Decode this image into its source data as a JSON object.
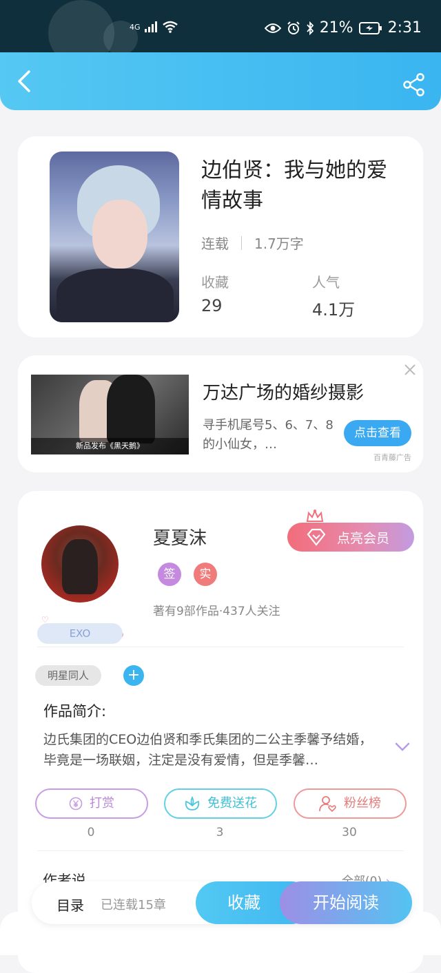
{
  "status_bar": {
    "network": "4G",
    "battery_percent": "21%",
    "time": "2:31"
  },
  "book": {
    "title": "边伯贤：我与她的爱情故事",
    "status": "连载",
    "word_count": "1.7万字",
    "favorites_label": "收藏",
    "favorites_value": "29",
    "popularity_label": "人气",
    "popularity_value": "4.1万"
  },
  "ad": {
    "title": "万达广场的婚纱摄影",
    "description": "寻手机尾号5、6、7、8的小仙女，…",
    "button_label": "点击查看",
    "source_tag": "百青藤广告",
    "image_caption": "新品发布《黑天鹅》"
  },
  "author": {
    "name": "夏夏沫",
    "vip_label": "点亮会员",
    "badge_sign": "签",
    "badge_real": "实",
    "stats": "著有9部作品·437人关注",
    "fan_tag": "EXO"
  },
  "genre_tag": "明星同人",
  "add_tag": "+",
  "intro": {
    "title": "作品简介:",
    "text": "边氏集团的CEO边伯贤和季氏集团的二公主季馨予结婚，毕竟是一场联姻，注定是没有爱情，但是季馨…"
  },
  "actions": [
    {
      "label": "打赏",
      "count": "0"
    },
    {
      "label": "免费送花",
      "count": "3"
    },
    {
      "label": "粉丝榜",
      "count": "30"
    }
  ],
  "author_note": {
    "title": "作者说",
    "all_label": "全部(0)"
  },
  "bottom_bar": {
    "toc_label": "目录",
    "serial_label": "已连载15章",
    "favorite_label": "收藏",
    "read_label": "开始阅读"
  },
  "colors": {
    "accent": "#3ab5f0",
    "vip_pink": "#f26d7a",
    "tip_purple": "#b88ad8",
    "flower_cyan": "#4fc7dc",
    "fans_red": "#e97a7a"
  }
}
